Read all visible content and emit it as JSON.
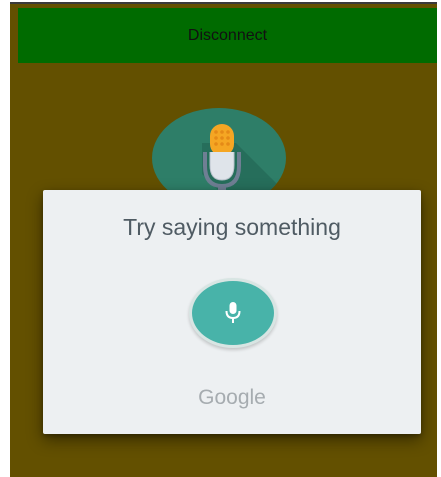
{
  "top_bar": {
    "button_label": "Disconnect"
  },
  "background_mic": {
    "icon": "microphone-icon"
  },
  "voice_dialog": {
    "prompt": "Try saying something",
    "mic_button_icon": "microphone-icon",
    "brand": "Google"
  },
  "colors": {
    "screen_bg": "#635000",
    "button_bg": "#006b00",
    "badge_bg": "#2e7e68",
    "dialog_bg": "#edf0f2",
    "mic_button": "#48b3a9"
  }
}
